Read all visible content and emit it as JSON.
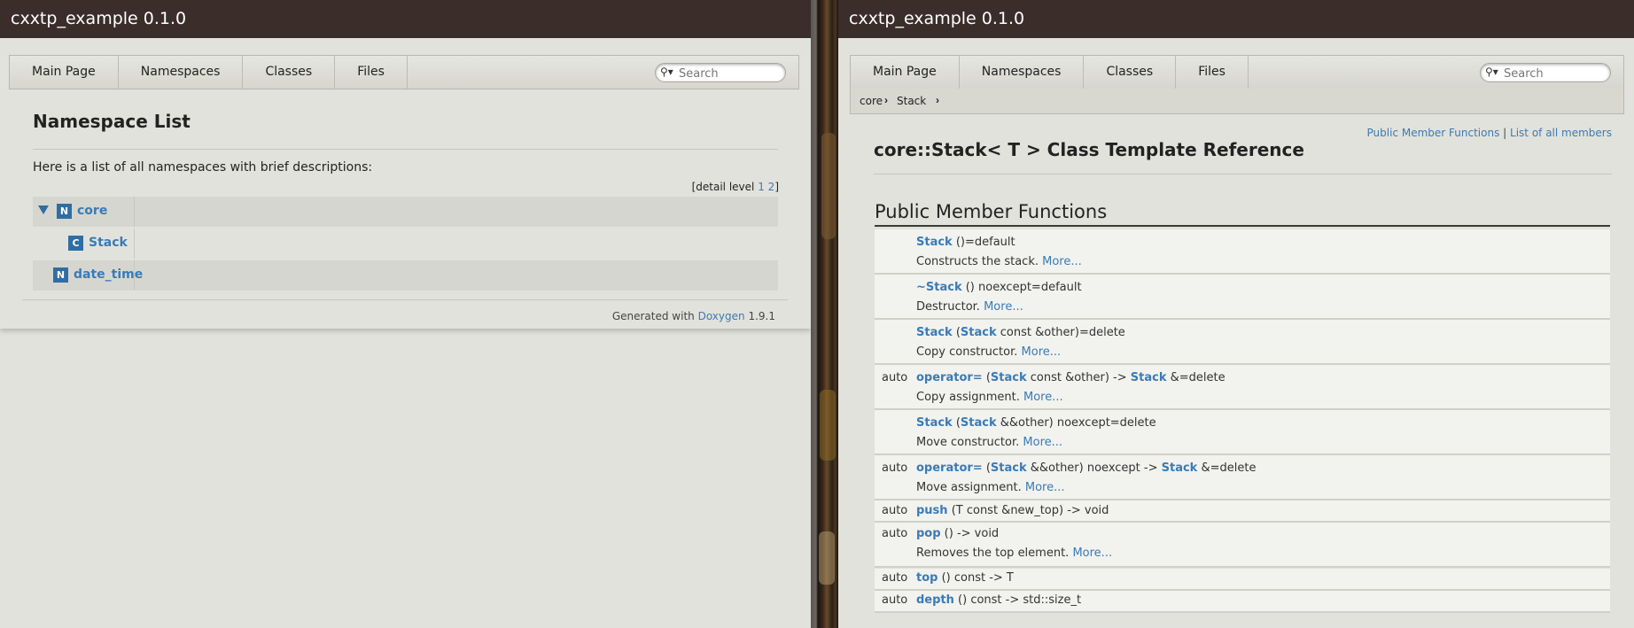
{
  "left": {
    "title": "cxxtp_example 0.1.0",
    "tabs": [
      "Main Page",
      "Namespaces",
      "Classes",
      "Files"
    ],
    "search_placeholder": "Search",
    "page_title": "Namespace List",
    "intro": "Here is a list of all namespaces with brief descriptions:",
    "detail_level": {
      "prefix": "[detail level",
      "levels": [
        "1",
        "2"
      ],
      "suffix": "]"
    },
    "tree": [
      {
        "badge": "N",
        "label": "core",
        "expanded": true
      },
      {
        "badge": "C",
        "label": "Stack"
      },
      {
        "badge": "N",
        "label": "date_time"
      }
    ],
    "footer": {
      "prefix": "Generated with",
      "tool": "Doxygen",
      "version": "1.9.1"
    }
  },
  "right": {
    "title": "cxxtp_example 0.1.0",
    "tabs": [
      "Main Page",
      "Namespaces",
      "Classes",
      "Files"
    ],
    "search_placeholder": "Search",
    "breadcrumb": [
      "core",
      "Stack"
    ],
    "summary_links": {
      "first": "Public Member Functions",
      "sep": "|",
      "second": "List of all members"
    },
    "page_title": "core::Stack< T > Class Template Reference",
    "section_title": "Public Member Functions",
    "members": [
      {
        "ret": "",
        "name": "Stack",
        "sig_rest": " ()=default",
        "desc": "Constructs the stack.",
        "more": "More..."
      },
      {
        "ret": "",
        "name": "~Stack",
        "sig_rest": " () noexcept=default",
        "desc": "Destructor.",
        "more": "More..."
      },
      {
        "ret": "",
        "name": "Stack",
        "sig_a": " (",
        "type1": "Stack",
        "sig_b": " const &other)=delete",
        "desc": "Copy constructor.",
        "more": "More..."
      },
      {
        "ret": "auto",
        "name": "operator=",
        "sig_a": " (",
        "type1": "Stack",
        "sig_b": " const &other) -> ",
        "type2": "Stack",
        "sig_c": " &=delete",
        "desc": "Copy assignment.",
        "more": "More..."
      },
      {
        "ret": "",
        "name": "Stack",
        "sig_a": " (",
        "type1": "Stack",
        "sig_b": " &&other) noexcept=delete",
        "desc": "Move constructor.",
        "more": "More..."
      },
      {
        "ret": "auto",
        "name": "operator=",
        "sig_a": " (",
        "type1": "Stack",
        "sig_b": " &&other) noexcept -> ",
        "type2": "Stack",
        "sig_c": " &=delete",
        "desc": "Move assignment.",
        "more": "More..."
      },
      {
        "ret": "auto",
        "name": "push",
        "sig_rest": " (T const &new_top) -> void"
      },
      {
        "ret": "auto",
        "name": "pop",
        "sig_rest": " () -> void",
        "desc": "Removes the top element.",
        "more": "More..."
      },
      {
        "ret": "auto",
        "name": "top",
        "sig_rest": " () const -> T"
      },
      {
        "ret": "auto",
        "name": "depth",
        "sig_rest": " () const -> std::size_t"
      }
    ]
  }
}
